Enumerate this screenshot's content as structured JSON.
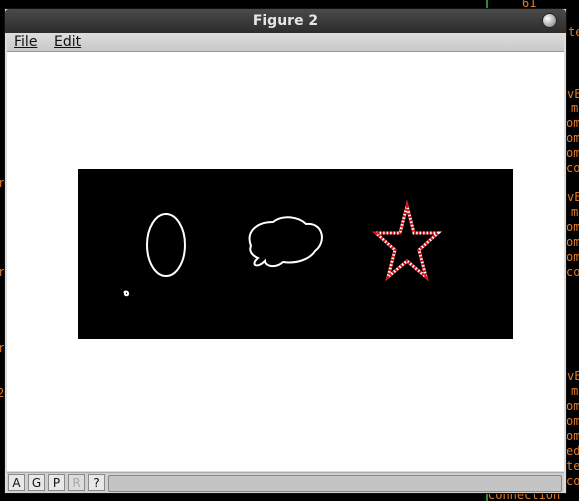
{
  "window": {
    "title": "Figure 2"
  },
  "menu": {
    "file_label": "File",
    "edit_label": "Edit"
  },
  "toolbar": {
    "buttons": [
      "A",
      "G",
      "P",
      "R",
      "?"
    ]
  },
  "terminal_fragments": {
    "right": [
      "61",
      "te",
      "vE",
      "m",
      "om",
      "om",
      "om",
      "co",
      "vE",
      "m",
      "om",
      "om",
      "om",
      "co",
      "vE",
      "m",
      "om",
      "om",
      "om",
      "ed",
      "te",
      "co",
      "ed",
      "Connection"
    ],
    "left": [
      "r",
      "r",
      "r",
      "2"
    ]
  },
  "figure": {
    "background": "#000000",
    "contour_color": "#ffffff",
    "highlight_color": "#e01010",
    "shapes": [
      "ellipse",
      "cloud",
      "star",
      "small-blob"
    ]
  }
}
